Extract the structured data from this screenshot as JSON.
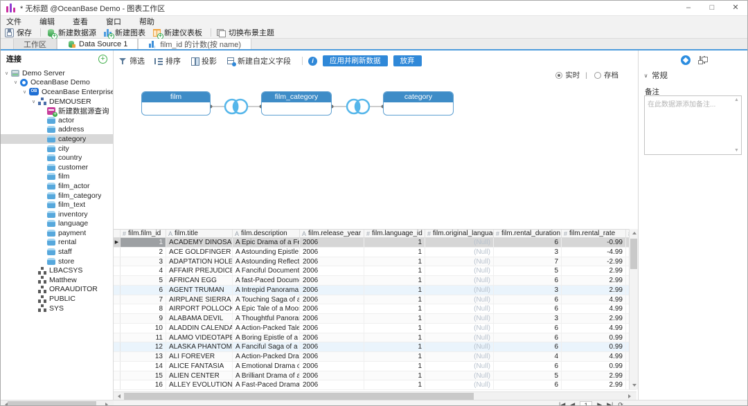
{
  "window": {
    "title": "* 无标题 @OceanBase Demo - 图表工作区",
    "controls": {
      "minimize": "–",
      "maximize": "□",
      "close": "✕"
    }
  },
  "menu": [
    "文件",
    "编辑",
    "查看",
    "窗口",
    "帮助"
  ],
  "toolbar": {
    "groups": [
      [
        {
          "id": "save",
          "label": "保存",
          "icon": "save-icon"
        }
      ],
      [
        {
          "id": "new-datasource",
          "label": "新建数据源",
          "icon": "new-datasource-icon"
        },
        {
          "id": "new-chart",
          "label": "新建图表",
          "icon": "new-chart-icon"
        },
        {
          "id": "new-dashboard",
          "label": "新建仪表板",
          "icon": "new-dashboard-icon"
        }
      ],
      [
        {
          "id": "switch-theme",
          "label": "切换布景主题",
          "icon": "switch-theme-icon"
        }
      ]
    ]
  },
  "tabs": [
    {
      "label": "工作区",
      "icon": null,
      "active": false
    },
    {
      "label": "Data Source 1",
      "icon": "datasource-icon",
      "active": true
    },
    {
      "label": "film_id 的计数(按 name)",
      "icon": "chart-icon",
      "active": false
    }
  ],
  "sidebar": {
    "title": "连接",
    "add_label": "+"
  },
  "tree": [
    {
      "label": "Demo Server",
      "depth": 0,
      "icon": "server-icon",
      "chevron": true
    },
    {
      "label": "OceanBase Demo",
      "depth": 1,
      "icon": "oceanbase-icon",
      "chevron": true
    },
    {
      "label": "OceanBase Enterprise Product",
      "depth": 2,
      "icon": "ob-database-icon",
      "chevron": true
    },
    {
      "label": "DEMOUSER",
      "depth": 3,
      "icon": "schema-blue-icon",
      "chevron": true
    },
    {
      "label": "新建数据源查询",
      "depth": 4,
      "icon": "new-query-icon"
    },
    {
      "label": "actor",
      "depth": 4,
      "icon": "table-icon"
    },
    {
      "label": "address",
      "depth": 4,
      "icon": "table-icon"
    },
    {
      "label": "category",
      "depth": 4,
      "icon": "table-icon",
      "selected": true
    },
    {
      "label": "city",
      "depth": 4,
      "icon": "table-icon"
    },
    {
      "label": "country",
      "depth": 4,
      "icon": "table-icon"
    },
    {
      "label": "customer",
      "depth": 4,
      "icon": "table-icon"
    },
    {
      "label": "film",
      "depth": 4,
      "icon": "table-icon"
    },
    {
      "label": "film_actor",
      "depth": 4,
      "icon": "table-icon"
    },
    {
      "label": "film_category",
      "depth": 4,
      "icon": "table-icon"
    },
    {
      "label": "film_text",
      "depth": 4,
      "icon": "table-icon"
    },
    {
      "label": "inventory",
      "depth": 4,
      "icon": "table-icon"
    },
    {
      "label": "language",
      "depth": 4,
      "icon": "table-icon"
    },
    {
      "label": "payment",
      "depth": 4,
      "icon": "table-icon"
    },
    {
      "label": "rental",
      "depth": 4,
      "icon": "table-icon"
    },
    {
      "label": "staff",
      "depth": 4,
      "icon": "table-icon"
    },
    {
      "label": "store",
      "depth": 4,
      "icon": "table-icon"
    },
    {
      "label": "LBACSYS",
      "depth": 3,
      "icon": "schema-icon"
    },
    {
      "label": "Matthew",
      "depth": 3,
      "icon": "schema-icon"
    },
    {
      "label": "ORAAUDITOR",
      "depth": 3,
      "icon": "schema-icon"
    },
    {
      "label": "PUBLIC",
      "depth": 3,
      "icon": "schema-icon"
    },
    {
      "label": "SYS",
      "depth": 3,
      "icon": "schema-icon"
    }
  ],
  "editor": {
    "buttons": [
      {
        "id": "filter",
        "label": "筛选",
        "icon": "filter-icon"
      },
      {
        "id": "sort",
        "label": "排序",
        "icon": "sort-icon"
      },
      {
        "id": "projection",
        "label": "投影",
        "icon": "projection-icon"
      },
      {
        "id": "new-custom-field",
        "label": "新建自定义字段",
        "icon": "new-field-icon"
      }
    ],
    "apply_label": "应用并刷新数据",
    "discard_label": "放弃",
    "mode": {
      "realtime_label": "实时",
      "archive_label": "存档",
      "selected": "realtime"
    }
  },
  "diagram": {
    "nodes": [
      {
        "name": "film"
      },
      {
        "name": "film_category"
      },
      {
        "name": "category"
      }
    ],
    "join_type": "inner-join"
  },
  "grid": {
    "columns": [
      {
        "type": "num",
        "label": "film.film_id"
      },
      {
        "type": "text",
        "label": "film.title"
      },
      {
        "type": "text",
        "label": "film.description"
      },
      {
        "type": "text",
        "label": "film.release_year"
      },
      {
        "type": "num",
        "label": "film.language_id"
      },
      {
        "type": "num",
        "label": "film.original_language_"
      },
      {
        "type": "num",
        "label": "film.rental_duration"
      },
      {
        "type": "num",
        "label": "film.rental_rate"
      },
      {
        "type": "num",
        "label": ""
      }
    ],
    "rows": [
      [
        "1",
        "ACADEMY DINOSAUR",
        "A Epic Drama of a Feminist",
        "2006",
        "1",
        "(Null)",
        "6",
        "-0.99"
      ],
      [
        "2",
        "ACE GOLDFINGER",
        "A Astounding Epistle of a D",
        "2006",
        "1",
        "(Null)",
        "3",
        "-4.99"
      ],
      [
        "3",
        "ADAPTATION HOLES",
        "A Astounding Reflection o",
        "2006",
        "1",
        "(Null)",
        "7",
        "-2.99"
      ],
      [
        "4",
        "AFFAIR PREJUDICE",
        "A Fanciful Documentary of",
        "2006",
        "1",
        "(Null)",
        "5",
        "2.99"
      ],
      [
        "5",
        "AFRICAN EGG",
        "A fast-Paced Documentary",
        "2006",
        "1",
        "(Null)",
        "6",
        "2.99"
      ],
      [
        "6",
        "AGENT TRUMAN",
        "A Intrepid Panorama of a F",
        "2006",
        "1",
        "(Null)",
        "3",
        "2.99"
      ],
      [
        "7",
        "AIRPLANE SIERRA",
        "A Touching Saga of a Hunt",
        "2006",
        "1",
        "(Null)",
        "6",
        "4.99"
      ],
      [
        "8",
        "AIRPORT POLLOCK",
        "A Epic Tale of a Moose And",
        "2006",
        "1",
        "(Null)",
        "6",
        "4.99"
      ],
      [
        "9",
        "ALABAMA DEVIL",
        "A Thoughtful Panorama of",
        "2006",
        "1",
        "(Null)",
        "3",
        "2.99"
      ],
      [
        "10",
        "ALADDIN CALENDAR II",
        "A Action-Packed Tale of a",
        "2006",
        "1",
        "(Null)",
        "6",
        "4.99"
      ],
      [
        "11",
        "ALAMO VIDEOTAPE",
        "A Boring Epistle of a Butler",
        "2006",
        "1",
        "(Null)",
        "6",
        "0.99"
      ],
      [
        "12",
        "ALASKA PHANTOM",
        "A Fanciful Saga of a Hunte",
        "2006",
        "1",
        "(Null)",
        "6",
        "0.99"
      ],
      [
        "13",
        "ALI FOREVER",
        "A Action-Packed Drama of",
        "2006",
        "1",
        "(Null)",
        "4",
        "4.99"
      ],
      [
        "14",
        "ALICE FANTASIA",
        "A Emotional Drama of a A",
        "2006",
        "1",
        "(Null)",
        "6",
        "0.99"
      ],
      [
        "15",
        "ALIEN CENTER",
        "A Brilliant Drama of a Cat A",
        "2006",
        "1",
        "(Null)",
        "5",
        "2.99"
      ],
      [
        "16",
        "ALLEY EVOLUTION",
        "A Fast-Paced Drama of a R",
        "2006",
        "1",
        "(Null)",
        "6",
        "2.99"
      ]
    ],
    "selected_row": 0,
    "highlight_rows": [
      5,
      11
    ]
  },
  "right_panel": {
    "section_title": "常规",
    "note_label": "备注",
    "note_placeholder": "在此数据源添加备注..."
  },
  "pagination": {
    "page": "1"
  },
  "colors": {
    "accent_blue": "#2f88d8",
    "node_header_blue": "#3e8cc7",
    "join_blue": "#55b6ea",
    "tab_underline": "#4d9cdc",
    "app_icon_magenta": "#cb2e9e",
    "add_green": "#3fae49",
    "null_text": "#b8c2ce"
  }
}
